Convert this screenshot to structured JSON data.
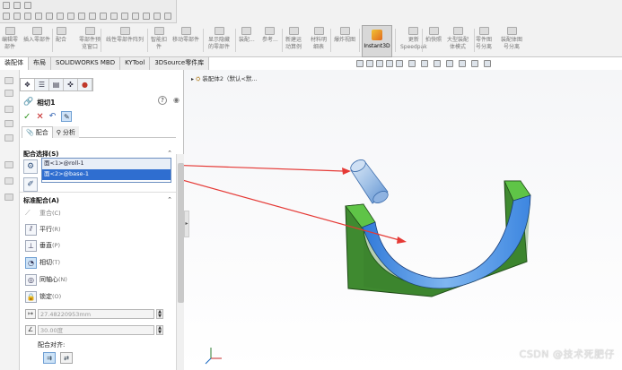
{
  "toolbar": {
    "items": [
      {
        "label": "编辑零\n部件"
      },
      {
        "label": "插入零部件"
      },
      {
        "label": "配合"
      },
      {
        "label": "零部件预\n览窗口"
      },
      {
        "label": "线性零部件阵列"
      },
      {
        "label": "智能扣\n件"
      },
      {
        "label": "移动零部件"
      },
      {
        "label": "显示隐藏\n的零部件"
      },
      {
        "label": "装配..."
      },
      {
        "label": "参考..."
      },
      {
        "label": "新建运\n动算例"
      },
      {
        "label": "材料明\n细表"
      },
      {
        "label": "爆炸视图"
      },
      {
        "label": "更新\nSpeedpak"
      },
      {
        "label": "拍快照"
      },
      {
        "label": "大型装配\n体模式"
      },
      {
        "label": "零件图\n号分离"
      },
      {
        "label": "装配体图\n号分离"
      }
    ],
    "instant3d": "Instant3D"
  },
  "tabs": [
    "装配体",
    "布局",
    "SOLIDWORKS MBD",
    "KYTool",
    "3DSource零件库"
  ],
  "pm": {
    "title": "相切1",
    "subtabs": [
      "配合",
      "分析"
    ],
    "selections_header": "配合选择(S)",
    "selections": [
      "面<1>@roll-1",
      "面<2>@base-1"
    ],
    "standard_header": "标准配合(A)",
    "mates": [
      {
        "label": "重合",
        "hotkey": "(C)"
      },
      {
        "label": "平行",
        "hotkey": "(R)"
      },
      {
        "label": "垂直",
        "hotkey": "(P)"
      },
      {
        "label": "相切",
        "hotkey": "(T)"
      },
      {
        "label": "同轴心",
        "hotkey": "(N)"
      },
      {
        "label": "锁定",
        "hotkey": "(O)"
      }
    ],
    "distance_value": "27.48220953mm",
    "angle_value": "30.00度",
    "alignment_label": "配合对齐:"
  },
  "viewport": {
    "tree_label": "装配体2（默认<默..."
  },
  "watermark": "CSDN @技术死肥仔",
  "colors": {
    "part_green": "#55b83d",
    "part_dark_green": "#3a7a2c",
    "roll_blue": "#4a90e2",
    "arrow_red": "#e53935",
    "selection_blue": "#2f6ed0"
  }
}
